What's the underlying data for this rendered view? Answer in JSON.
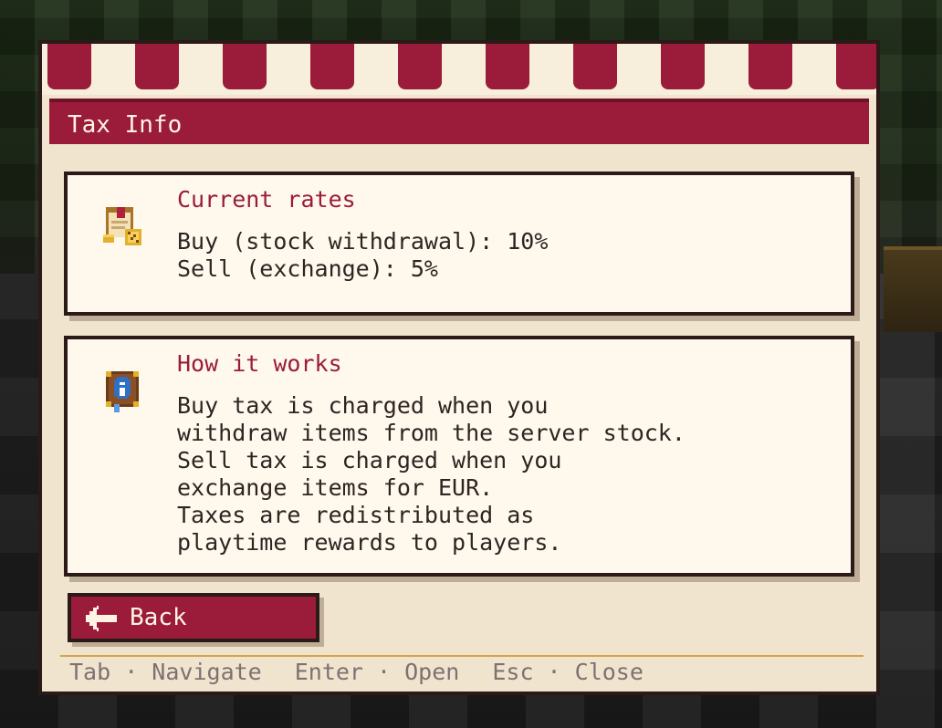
{
  "window": {
    "title": "Tax Info"
  },
  "rates_card": {
    "heading": "Current rates",
    "icon": "tax-scroll-icon",
    "lines": [
      "Buy (stock withdrawal): 10%",
      "Sell (exchange): 5%"
    ]
  },
  "info_card": {
    "heading": "How it works",
    "icon": "info-book-icon",
    "lines": [
      "Buy tax is charged when you",
      "withdraw items from the server stock.",
      "Sell tax is charged when you",
      "exchange items for EUR.",
      "Taxes are redistributed as",
      "playtime rewards to players."
    ]
  },
  "back_button": {
    "label": "Back",
    "icon": "back-arrow-icon"
  },
  "hints": [
    "Tab · Navigate",
    "Enter · Open",
    "Esc · Close"
  ],
  "colors": {
    "accent": "#9a1c3a",
    "panel": "#f1e4cf",
    "card": "#fff8ec",
    "divider": "#d6a24a"
  }
}
